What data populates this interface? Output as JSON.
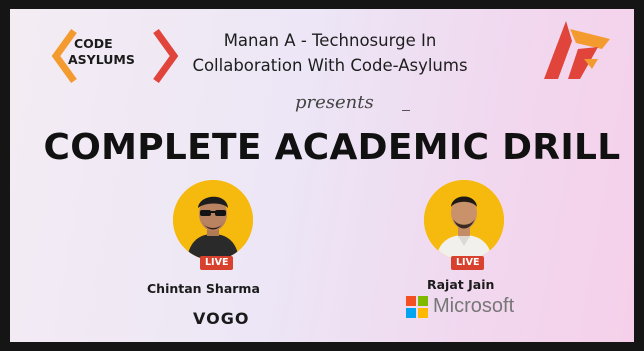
{
  "brand_left": {
    "line1": "CODE",
    "line2": "ASYLUMS"
  },
  "header": {
    "line1": "Manan A - Technosurge In",
    "line2": "Collaboration With Code-Asylums"
  },
  "presents": "presents",
  "title": "COMPLETE ACADEMIC DRILL",
  "speakers": [
    {
      "name": "Chintan Sharma",
      "badge": "LIVE",
      "company": "VOGO"
    },
    {
      "name": "Rajat Jain",
      "badge": "LIVE",
      "company": "Microsoft"
    }
  ],
  "colors": {
    "accent_red": "#e0443a",
    "accent_orange": "#f39b2f",
    "avatar_ring": "#f6b90d",
    "live_badge": "#d8412e",
    "ms_red": "#f25022",
    "ms_green": "#7fba00",
    "ms_blue": "#00a4ef",
    "ms_yellow": "#ffb900"
  }
}
